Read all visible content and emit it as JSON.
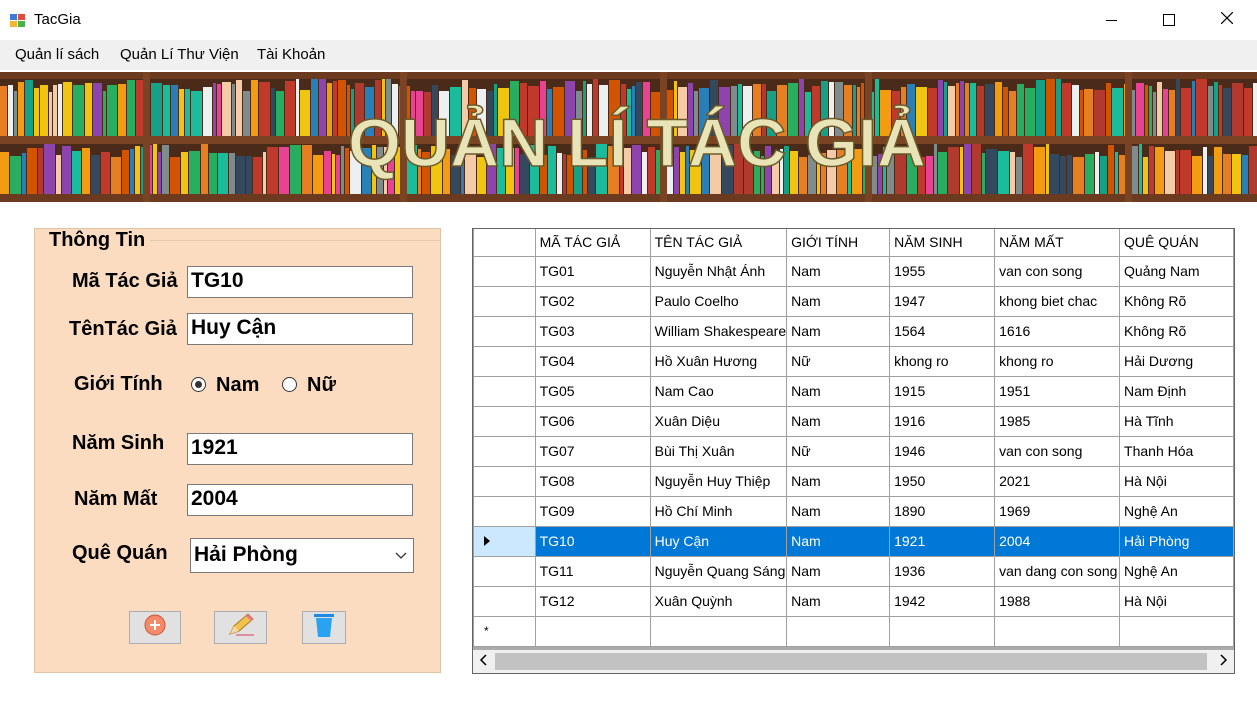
{
  "window": {
    "title": "TacGia"
  },
  "menu": [
    "Quản lí sách",
    "Quản Lí Thư Viện",
    "Tài Khoản"
  ],
  "banner": {
    "title": "QUẢN LÍ TÁC GIẢ"
  },
  "form": {
    "group_title": "Thông Tin",
    "ma_label": "Mã Tác Giả",
    "ma_value": "TG10",
    "ten_label": "TênTác Giả",
    "ten_value": "Huy Cận",
    "gioitinh_label": "Giới Tính",
    "radio_nam": "Nam",
    "radio_nu": "Nữ",
    "selected_gender": "Nam",
    "namsinh_label": "Năm Sinh",
    "namsinh_value": "1921",
    "nammat_label": "Năm Mất",
    "nammat_value": "2004",
    "quequan_label": "Quê Quán",
    "quequan_value": "Hải Phòng"
  },
  "grid": {
    "columns": [
      "MÃ TÁC GIẢ",
      "TÊN TÁC GIẢ",
      "GIỚI TÍNH",
      "NĂM SINH",
      "NĂM MẤT",
      "QUÊ QUÁN"
    ],
    "selected_index": 9,
    "new_row_marker": "*",
    "rows": [
      [
        "TG01",
        "Nguyễn Nhật Ánh",
        "Nam",
        "1955",
        "van con song",
        "Quảng Nam"
      ],
      [
        "TG02",
        "Paulo Coelho",
        "Nam",
        "1947",
        "khong biet chac",
        "Không Rõ"
      ],
      [
        "TG03",
        "William Shakespeare",
        "Nam",
        "1564",
        "1616",
        "Không Rõ"
      ],
      [
        "TG04",
        "Hồ Xuân Hương",
        "Nữ",
        "khong ro",
        "khong ro",
        "Hải Dương"
      ],
      [
        "TG05",
        "Nam Cao",
        "Nam",
        "1915",
        "1951",
        "Nam Định"
      ],
      [
        "TG06",
        "Xuân Diệu",
        "Nam",
        "1916",
        "1985",
        "Hà Tĩnh"
      ],
      [
        "TG07",
        "Bùi Thị Xuân",
        "Nữ",
        "1946",
        "van con song",
        "Thanh Hóa"
      ],
      [
        "TG08",
        "Nguyễn Huy Thiệp",
        "Nam",
        "1950",
        "2021",
        "Hà Nội"
      ],
      [
        "TG09",
        "Hồ Chí Minh",
        "Nam",
        "1890",
        "1969",
        "Nghệ An"
      ],
      [
        "TG10",
        "Huy Cận",
        "Nam",
        "1921",
        "2004",
        "Hải Phòng"
      ],
      [
        "TG11",
        "Nguyễn Quang Sáng",
        "Nam",
        "1936",
        "van dang con song",
        "Nghệ An"
      ],
      [
        "TG12",
        "Xuân Quỳnh",
        "Nam",
        "1942",
        "1988",
        "Hà Nội"
      ]
    ]
  }
}
